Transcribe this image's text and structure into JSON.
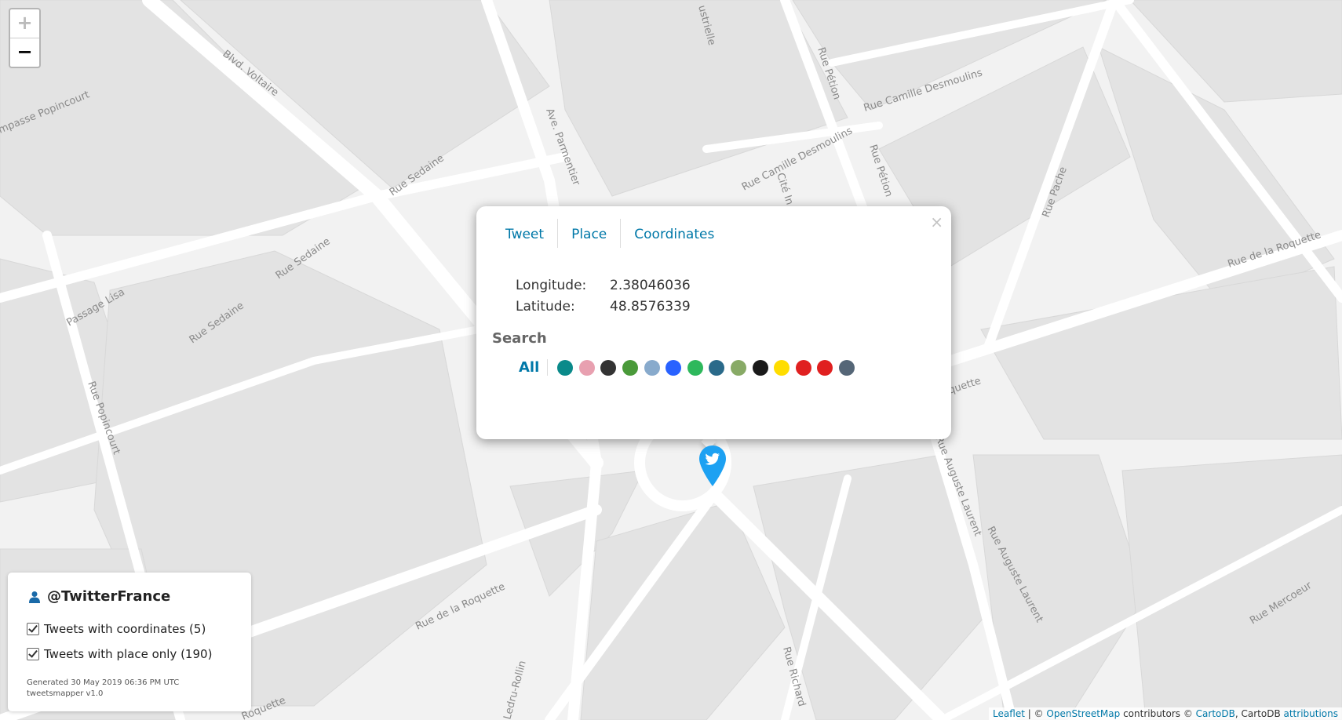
{
  "map": {
    "street_labels": [
      {
        "text": "Blvd. Voltaire"
      },
      {
        "text": "mpasse Popincourt"
      },
      {
        "text": "Rue Sedaine"
      },
      {
        "text": "Rue Sedaine"
      },
      {
        "text": "Rue Sedaine"
      },
      {
        "text": "Passage Lisa"
      },
      {
        "text": "Rue Popincourt"
      },
      {
        "text": "Ave. Parmentier"
      },
      {
        "text": "Rue Pétion"
      },
      {
        "text": "Rue Pétion"
      },
      {
        "text": "Rue Camille Desmoulins"
      },
      {
        "text": "Rue Camille Desmoulins"
      },
      {
        "text": "Rue Pache"
      },
      {
        "text": "Rue de la Roquette"
      },
      {
        "text": "Rue de la Roquette"
      },
      {
        "text": "Rue Auguste Laurent"
      },
      {
        "text": "Rue Auguste Laurent"
      },
      {
        "text": "Rue Mercoeur"
      },
      {
        "text": "Rue Richard"
      },
      {
        "text": "Ledru-Rollin"
      },
      {
        "text": "Roquette"
      },
      {
        "text": "ustrielle"
      },
      {
        "text": "Cité In"
      },
      {
        "text": "quette"
      }
    ]
  },
  "zoom": {
    "in_label": "+",
    "out_label": "−"
  },
  "popup": {
    "close_label": "×",
    "tabs": [
      "Tweet",
      "Place",
      "Coordinates"
    ],
    "longitude_label": "Longitude:",
    "longitude_value": "2.38046036",
    "latitude_label": "Latitude:",
    "latitude_value": "48.8576339",
    "search_title": "Search",
    "search_all_label": "All",
    "search_engines": [
      {
        "name": "bing-icon",
        "color": "#0a8a8a"
      },
      {
        "name": "multicolor-blob-icon",
        "color": "#e8a0b0"
      },
      {
        "name": "here-icon",
        "color": "#333333"
      },
      {
        "name": "google-maps-icon",
        "color": "#4a9a3a"
      },
      {
        "name": "globe-icon",
        "color": "#88aacc"
      },
      {
        "name": "blue-circle-icon",
        "color": "#2962ff"
      },
      {
        "name": "green-circle-icon",
        "color": "#2eb85c"
      },
      {
        "name": "map-photo-icon",
        "color": "#2a6a8a"
      },
      {
        "name": "map-search-icon",
        "color": "#88aa66"
      },
      {
        "name": "s-icon",
        "color": "#1a1a1a"
      },
      {
        "name": "yellow-pin-icon",
        "color": "#ffdd00"
      },
      {
        "name": "red-moon-icon",
        "color": "#e02020"
      },
      {
        "name": "red-pin-icon",
        "color": "#e02020"
      },
      {
        "name": "earth-icon",
        "color": "#556677"
      }
    ]
  },
  "marker": {
    "icon": "twitter-marker-icon",
    "color": "#1da1f2"
  },
  "legend": {
    "user": "@TwitterFrance",
    "items": [
      {
        "label": "Tweets with coordinates (5)",
        "checked": true
      },
      {
        "label": "Tweets with place only (190)",
        "checked": true
      }
    ],
    "generated": "Generated 30 May 2019 06:36 PM UTC",
    "version": "tweetsmapper v1.0"
  },
  "attribution": {
    "leaflet": "Leaflet",
    "sep1": " | © ",
    "osm": "OpenStreetMap",
    "contributors": " contributors © ",
    "cartodb": "CartoDB",
    "sep2": ", CartoDB ",
    "attributions": "attributions"
  }
}
